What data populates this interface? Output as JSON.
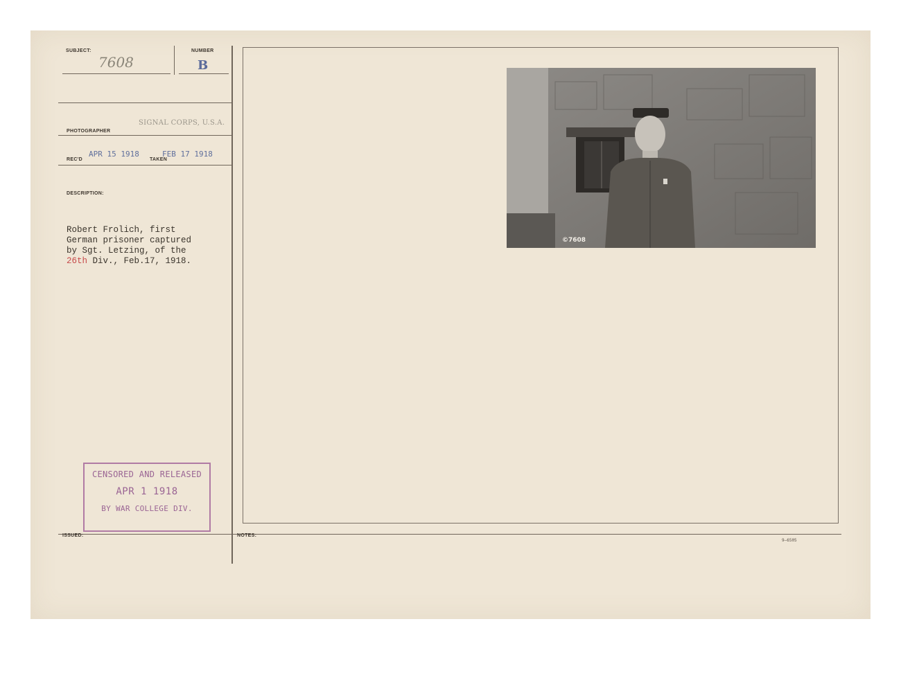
{
  "labels": {
    "subject": "SUBJECT:",
    "number": "NUMBER",
    "photographer": "PHOTOGRAPHER",
    "recd": "REC'D",
    "taken": "TAKEN",
    "description": "DESCRIPTION:",
    "issued": "ISSUED:",
    "notes": "NOTES:"
  },
  "subject_number": "7608",
  "number_letter": "B",
  "photographer": "SIGNAL CORPS, U.S.A.",
  "recd_date": "APR 15 1918",
  "taken_date": "FEB 17 1918",
  "description": {
    "line1": "Robert Frolich, first",
    "line2": "German prisoner captured",
    "line3": "by Sgt. Letzing, of the",
    "line4_red": "26th",
    "line4_rest": " Div., Feb.17, 1918."
  },
  "censor_stamp": {
    "line1": "CENSORED AND RELEASED",
    "line2": "APR 1  1918",
    "line3": "BY WAR COLLEGE DIV."
  },
  "photo_number": "©7608",
  "form_code": "9—6505",
  "colors": {
    "card": "#efe6d6",
    "stamp_blue": "#5f6f9c",
    "censor_purple": "#9a6494",
    "red_ink": "#c64a4a"
  }
}
